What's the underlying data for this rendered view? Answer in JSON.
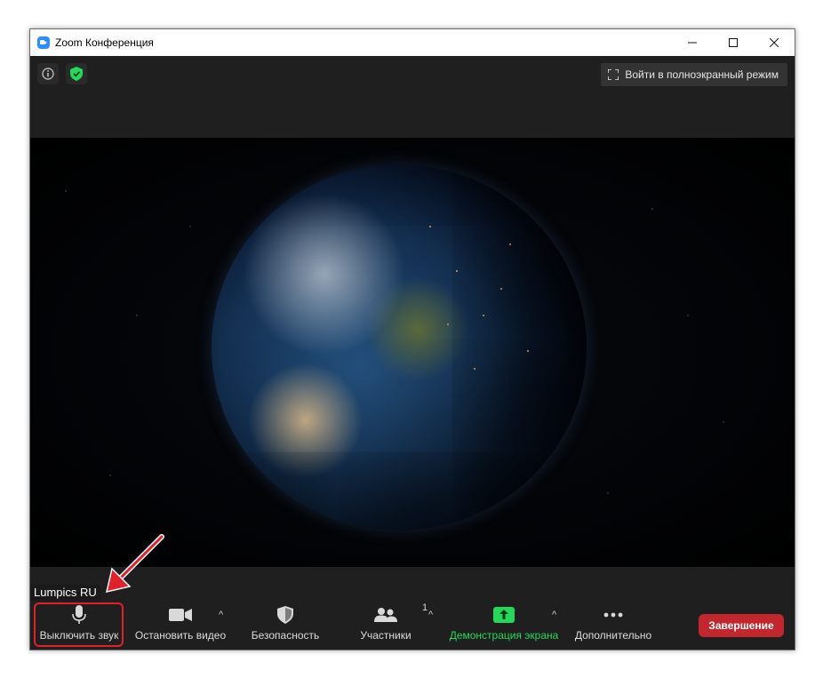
{
  "window": {
    "title": "Zoom Конференция",
    "controls": {
      "minimize": "—",
      "maximize": "☐",
      "close": "✕"
    }
  },
  "top": {
    "fullscreen_label": "Войти в полноэкранный режим"
  },
  "participant_name": "Lumpics RU",
  "toolbar": {
    "mute_label": "Выключить звук",
    "video_label": "Остановить видео",
    "security_label": "Безопасность",
    "participants_label": "Участники",
    "participants_count": "1",
    "share_label": "Демонстрация экрана",
    "more_label": "Дополнительно",
    "end_label": "Завершение",
    "caret": "^"
  },
  "colors": {
    "accent_green": "#23d959",
    "end_red": "#c1272d",
    "highlight_red": "#e0202a"
  }
}
